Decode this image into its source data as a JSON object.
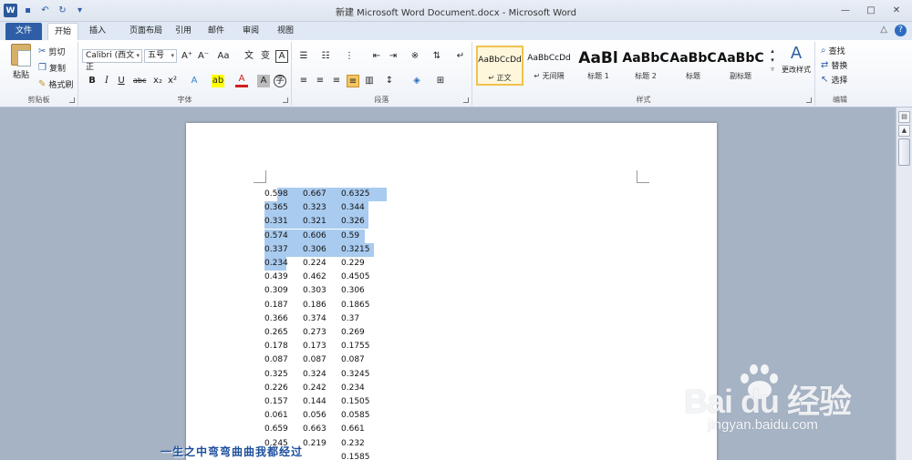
{
  "window": {
    "title": "新建 Microsoft Word Document.docx - Microsoft Word",
    "controls": [
      "—",
      "□",
      "✕"
    ]
  },
  "tabs": {
    "file": "文件",
    "items": [
      "开始",
      "插入",
      "页面布局",
      "引用",
      "邮件",
      "审阅",
      "视图"
    ],
    "active": "开始"
  },
  "ribbon": {
    "clipboard": {
      "paste": "粘贴",
      "cut": "剪切",
      "copy": "复制",
      "format_painter": "格式刷",
      "label": "剪贴板"
    },
    "font": {
      "name": "Calibri (西文正",
      "size": "五号",
      "label": "字体"
    },
    "paragraph": {
      "label": "段落"
    },
    "styles": {
      "label": "样式",
      "items": [
        {
          "sample": "AaBbCcDd",
          "name": "↵ 正文"
        },
        {
          "sample": "AaBbCcDd",
          "name": "↵ 无间隔"
        },
        {
          "sample": "AaBl",
          "name": "标题 1"
        },
        {
          "sample": "AaBbC",
          "name": "标题 2"
        },
        {
          "sample": "AaBbC",
          "name": "标题"
        },
        {
          "sample": "AaBbC",
          "name": "副标题"
        }
      ],
      "change": "更改样式"
    },
    "editing": {
      "find": "查找",
      "replace": "替换",
      "select": "选择",
      "label": "编辑"
    }
  },
  "document": {
    "rows": [
      [
        "0.598",
        "0.667",
        "0.6325"
      ],
      [
        "0.365",
        "0.323",
        "0.344"
      ],
      [
        "0.331",
        "0.321",
        "0.326"
      ],
      [
        "0.574",
        "0.606",
        "0.59"
      ],
      [
        "0.337",
        "0.306",
        "0.3215"
      ],
      [
        "0.234",
        "0.224",
        "0.229"
      ],
      [
        "0.439",
        "0.462",
        "0.4505"
      ],
      [
        "0.309",
        "0.303",
        "0.306"
      ],
      [
        "0.187",
        "0.186",
        "0.1865"
      ],
      [
        "0.366",
        "0.374",
        "0.37"
      ],
      [
        "0.265",
        "0.273",
        "0.269"
      ],
      [
        "0.178",
        "0.173",
        "0.1755"
      ],
      [
        "0.087",
        "0.087",
        "0.087"
      ],
      [
        "0.325",
        "0.324",
        "0.3245"
      ],
      [
        "0.226",
        "0.242",
        "0.234"
      ],
      [
        "0.157",
        "0.144",
        "0.1505"
      ],
      [
        "0.061",
        "0.056",
        "0.0585"
      ],
      [
        "0.659",
        "0.663",
        "0.661"
      ],
      [
        "0.245",
        "0.219",
        "0.232"
      ],
      [
        "",
        "",
        "0.1585"
      ]
    ]
  },
  "watermark": {
    "brand": "Bai du 经验",
    "url": "jingyan.baidu.com"
  },
  "caption": "一生之中弯弯曲曲我都经过"
}
